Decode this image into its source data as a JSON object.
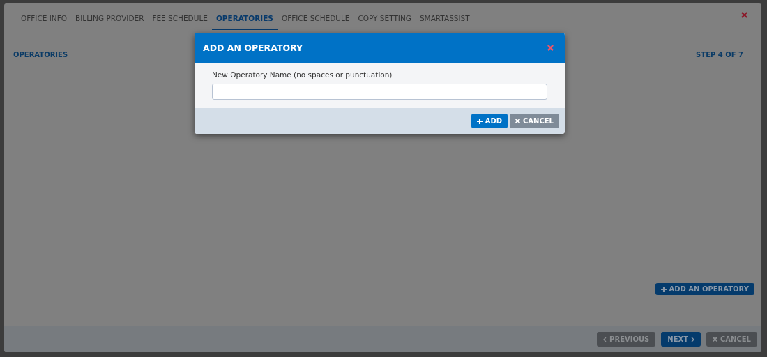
{
  "tabs": [
    {
      "label": "OFFICE INFO",
      "selected": false
    },
    {
      "label": "BILLING PROVIDER",
      "selected": false
    },
    {
      "label": "FEE SCHEDULE",
      "selected": false
    },
    {
      "label": "OPERATORIES",
      "selected": true
    },
    {
      "label": "OFFICE SCHEDULE",
      "selected": false
    },
    {
      "label": "COPY SETTING",
      "selected": false
    },
    {
      "label": "SMARTASSIST",
      "selected": false
    }
  ],
  "section_title": "OPERATORIES",
  "step": "STEP 4 OF 7",
  "add_operatory_button": "ADD AN OPERATORY",
  "footer_buttons": [
    {
      "label": "PREVIOUS",
      "kind": "previous"
    },
    {
      "label": "NEXT",
      "kind": "next"
    },
    {
      "label": "CANCEL",
      "kind": "cancel"
    }
  ],
  "dialog": {
    "title": "ADD AN OPERATORY",
    "field_label": "New Operatory Name (no spaces or punctuation)",
    "buttons": [
      {
        "label": "ADD",
        "kind": "add"
      },
      {
        "label": "CANCEL",
        "kind": "cancel"
      }
    ]
  }
}
